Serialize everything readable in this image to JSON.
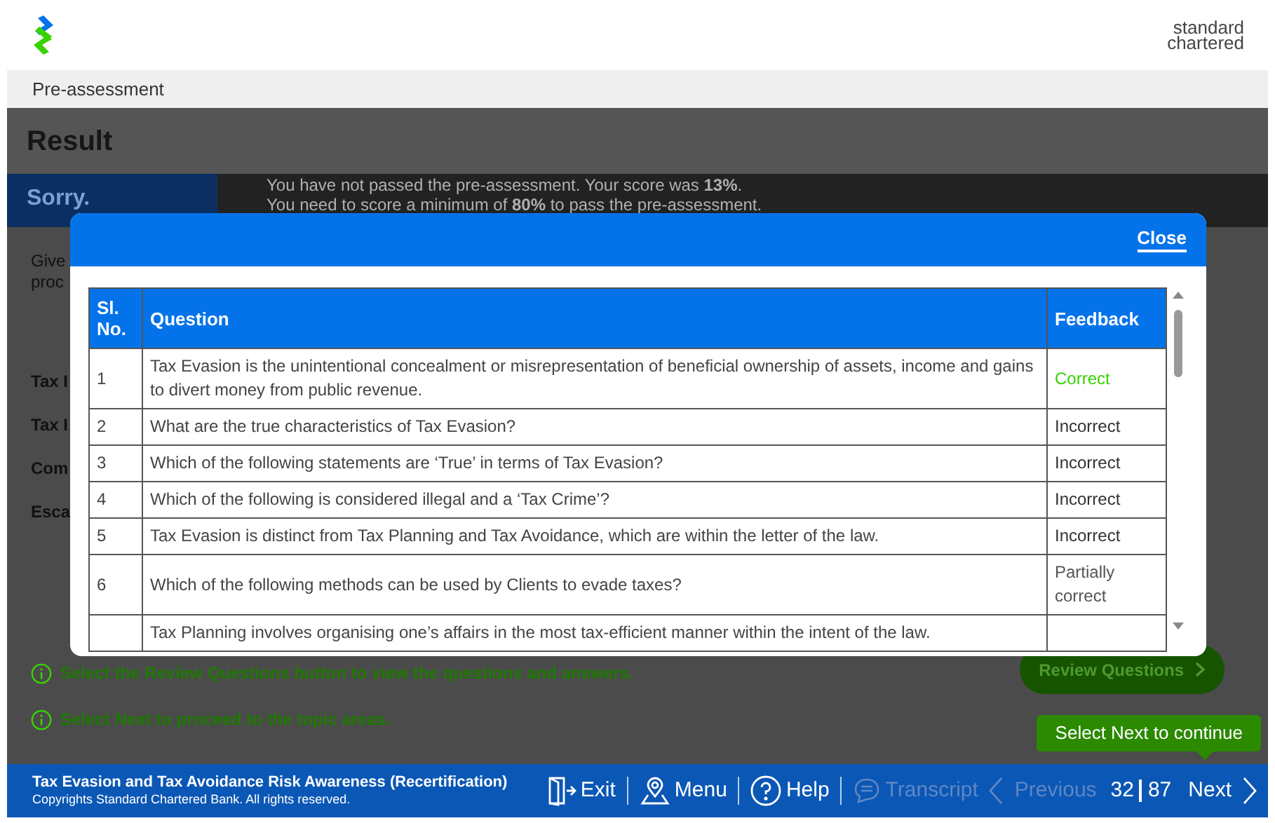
{
  "header": {
    "brand_lines": [
      "standard",
      "chartered"
    ]
  },
  "breadcrumb": "Pre-assessment",
  "page": {
    "title": "Result",
    "banner": {
      "label": "Sorry.",
      "lines": [
        "You have not passed the pre-assessment. Your score was **13%**.",
        "You need to score a minimum of **80%** to pass the pre-assessment."
      ]
    },
    "intro_fragments": [
      "Give",
      "proc"
    ],
    "topic_fragments": [
      "Tax I",
      "Tax I",
      "Com",
      "Esca"
    ],
    "instructions": [
      "Select the Review Questions button to view the questions and answers.",
      "Select Next to proceed to the topic areas."
    ],
    "review_button": "Review Questions"
  },
  "modal": {
    "close": "Close",
    "columns": [
      "Sl. No.",
      "Question",
      "Feedback"
    ],
    "rows": [
      {
        "no": "1",
        "question": "Tax Evasion is the unintentional concealment or misrepresentation of beneficial ownership of assets, income and gains to divert money from public revenue.",
        "feedback": "Correct",
        "kind": "correct"
      },
      {
        "no": "2",
        "question": "What are the true characteristics of Tax Evasion?",
        "feedback": "Incorrect",
        "kind": "incorrect"
      },
      {
        "no": "3",
        "question": "Which of the following statements are ‘True’ in terms of Tax Evasion?",
        "feedback": "Incorrect",
        "kind": "incorrect"
      },
      {
        "no": "4",
        "question": "Which of the following is considered illegal and a ‘Tax Crime’?",
        "feedback": "Incorrect",
        "kind": "incorrect"
      },
      {
        "no": "5",
        "question": "Tax Evasion is distinct from Tax Planning and Tax Avoidance, which are within the letter of the law.",
        "feedback": "Incorrect",
        "kind": "incorrect"
      },
      {
        "no": "6",
        "question": "Which of the following methods can be used by Clients to evade taxes?",
        "feedback": "Partially correct",
        "kind": "partial"
      },
      {
        "no": "",
        "question": "Tax Planning involves organising one’s affairs in the most tax-efficient manner within the intent of the law.",
        "feedback": "",
        "kind": "incorrect"
      }
    ]
  },
  "tooltip": "Select Next to continue",
  "footer": {
    "course": "Tax Evasion and Tax Avoidance Risk Awareness (Recertification)",
    "copyright": "Copyrights Standard Chartered Bank. All rights reserved.",
    "nav": [
      {
        "label": "Exit",
        "kind": "exit",
        "disabled": false
      },
      {
        "label": "Menu",
        "kind": "menu",
        "disabled": false
      },
      {
        "label": "Help",
        "kind": "help",
        "disabled": false
      },
      {
        "label": "Transcript",
        "kind": "transcript",
        "disabled": true
      }
    ],
    "previous": {
      "label": "Previous",
      "disabled": true
    },
    "page_current": "32",
    "page_total": "87",
    "next": {
      "label": "Next",
      "disabled": false
    }
  }
}
